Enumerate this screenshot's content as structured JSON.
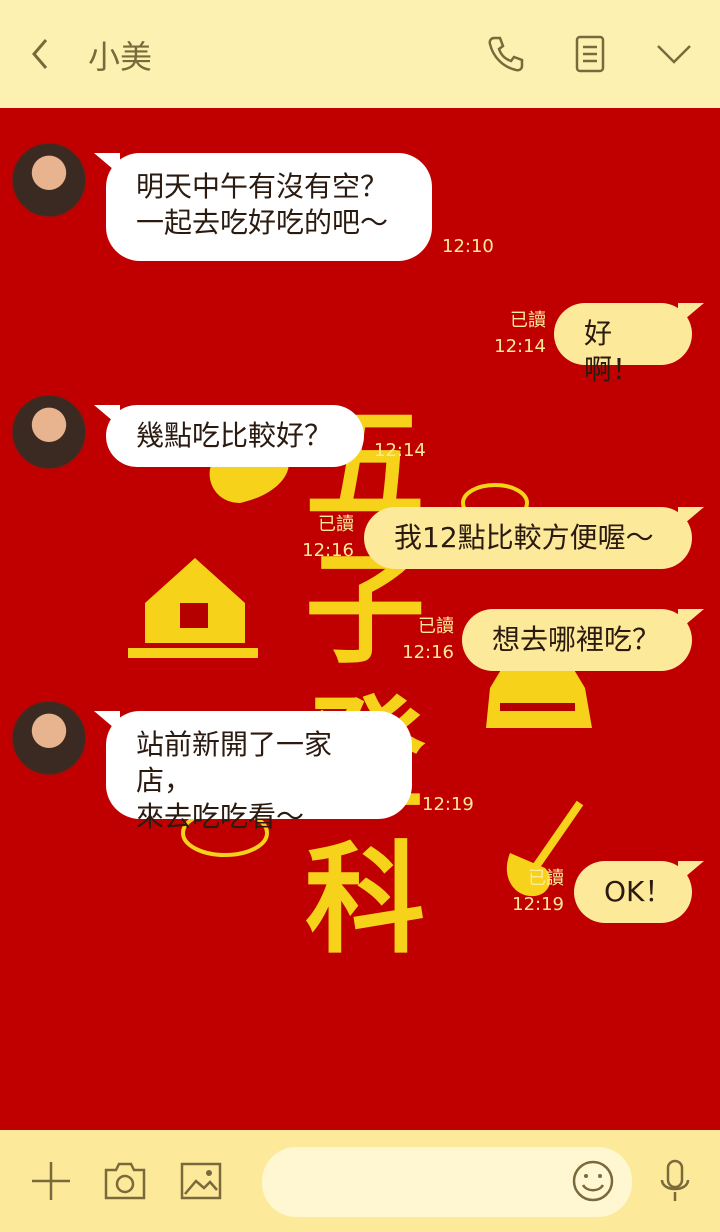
{
  "header": {
    "title": "小美",
    "icons": [
      "back-icon",
      "phone-icon",
      "notes-icon",
      "chevron-down-icon"
    ]
  },
  "background": {
    "characters": [
      "五",
      "子",
      "登",
      "科"
    ],
    "color": "#c00000",
    "accent": "#f7d21b"
  },
  "messages": [
    {
      "side": "in",
      "lines": [
        "明天中午有沒有空？",
        "一起去吃好吃的吧～"
      ],
      "time": "12:10"
    },
    {
      "side": "out",
      "text": "好啊！",
      "read": "已讀",
      "time": "12:14"
    },
    {
      "side": "in",
      "text": "幾點吃比較好？",
      "time": "12:14"
    },
    {
      "side": "out",
      "text": "我12點比較方便喔～",
      "read": "已讀",
      "time": "12:16"
    },
    {
      "side": "out",
      "text": "想去哪裡吃？",
      "read": "已讀",
      "time": "12:16"
    },
    {
      "side": "in",
      "lines": [
        "站前新開了一家店，",
        "來去吃吃看～"
      ],
      "time": "12:19"
    },
    {
      "side": "out",
      "text": "OK！",
      "read": "已讀",
      "time": "12:19"
    }
  ],
  "footer": {
    "icons": [
      "plus-icon",
      "camera-icon",
      "image-icon",
      "emoji-icon",
      "microphone-icon"
    ],
    "input_value": ""
  }
}
